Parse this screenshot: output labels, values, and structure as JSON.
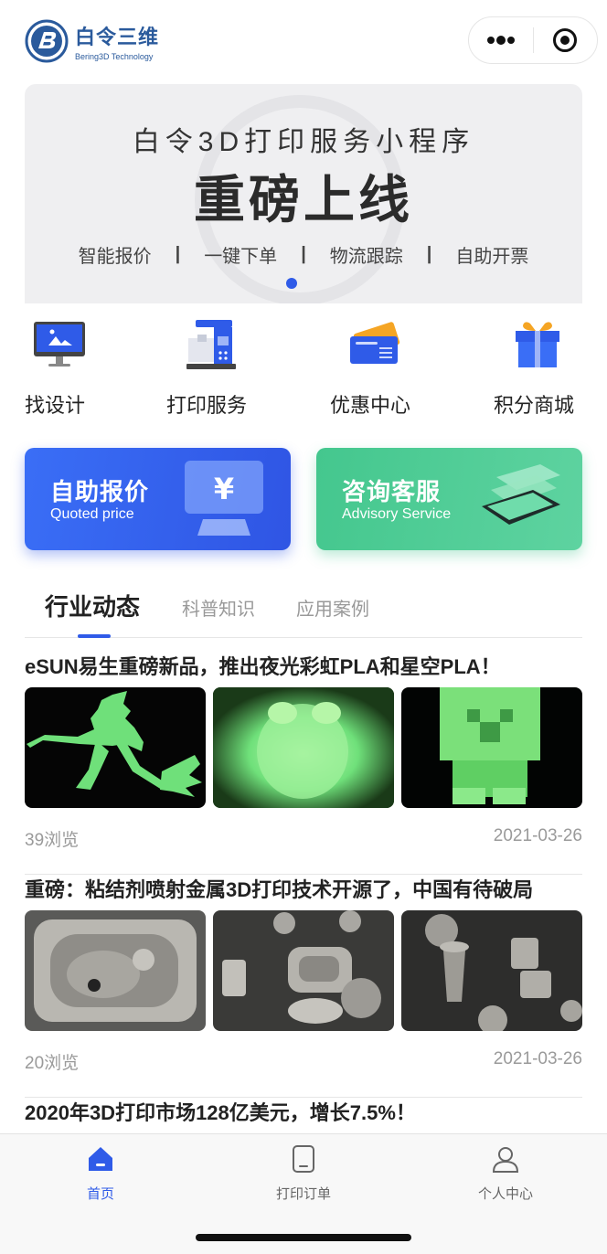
{
  "header": {
    "logo_cn": "白令三维",
    "logo_en": "Bering3D Technology",
    "capsule_more_icon": "more-dots-icon",
    "capsule_close_icon": "target-close-icon"
  },
  "banner": {
    "subtitle": "白令3D打印服务小程序",
    "title": "重磅上线",
    "features": [
      "智能报价",
      "一键下单",
      "物流跟踪",
      "自助开票"
    ],
    "separator": "|",
    "active_page": 1,
    "page_count": 1
  },
  "quick_menu": [
    {
      "label": "找设计",
      "icon": "monitor-design-icon"
    },
    {
      "label": "打印服务",
      "icon": "printer-machine-icon"
    },
    {
      "label": "优惠中心",
      "icon": "coupon-ticket-icon"
    },
    {
      "label": "积分商城",
      "icon": "gift-box-icon"
    }
  ],
  "cards": {
    "quote": {
      "title": "自助报价",
      "subtitle": "Quoted price",
      "icon": "yen-screen-icon"
    },
    "service": {
      "title": "咨询客服",
      "subtitle": "Advisory Service",
      "icon": "phone-stack-icon"
    }
  },
  "tabs": [
    {
      "label": "行业动态",
      "active": true
    },
    {
      "label": "科普知识",
      "active": false
    },
    {
      "label": "应用案例",
      "active": false
    }
  ],
  "articles": [
    {
      "title": "eSUN易生重磅新品，推出夜光彩虹PLA和星空PLA！",
      "views": "39浏览",
      "date": "2021-03-26",
      "images": [
        "glow-witch-image",
        "glow-dog-image",
        "glow-creeper-image"
      ]
    },
    {
      "title": "重磅：粘结剂喷射金属3D打印技术开源了，中国有待破局",
      "views": "20浏览",
      "date": "2021-03-26",
      "images": [
        "metal-housing-image",
        "metal-parts-image",
        "metal-nozzle-image"
      ]
    },
    {
      "title": "2020年3D打印市场128亿美元，增长7.5%！"
    }
  ],
  "tabbar": [
    {
      "label": "首页",
      "icon": "home-icon",
      "active": true
    },
    {
      "label": "打印订单",
      "icon": "order-doc-icon",
      "active": false
    },
    {
      "label": "个人中心",
      "icon": "user-profile-icon",
      "active": false
    }
  ],
  "colors": {
    "primary": "#2f5be8",
    "green": "#44c78e",
    "glow": "#7de07f"
  }
}
